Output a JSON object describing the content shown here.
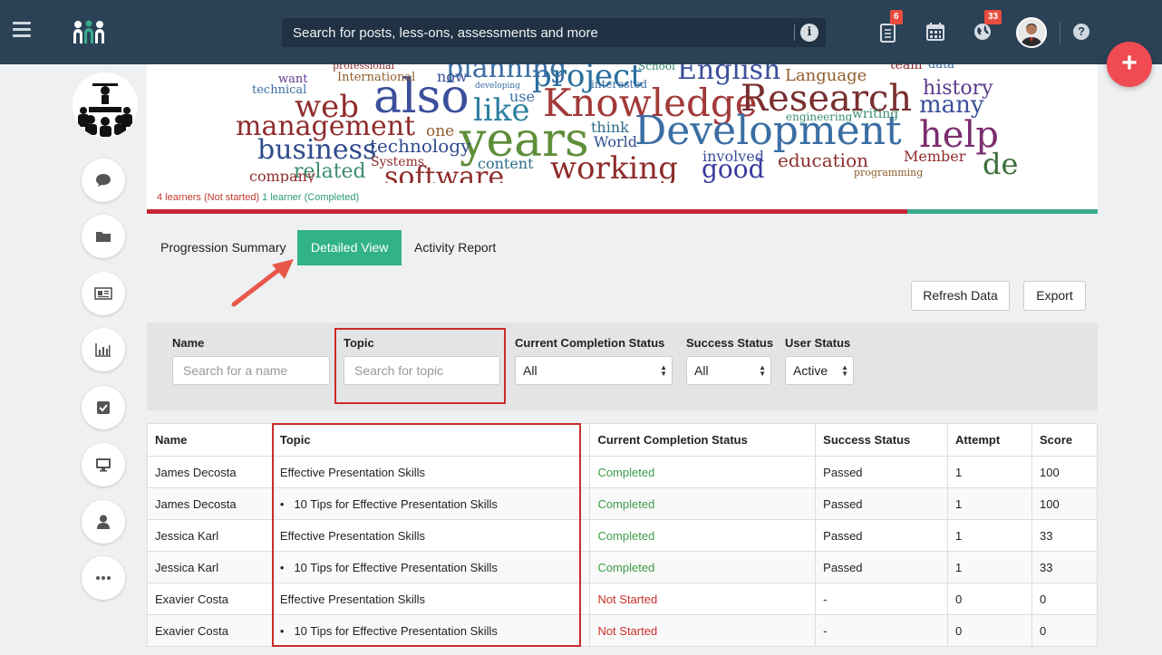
{
  "header": {
    "search_placeholder": "Search for posts, less-ons, assessments and more",
    "notifications_badge": "6",
    "globe_badge": "33",
    "help_label": "?",
    "info_label": "i",
    "fab_label": "+"
  },
  "sidebar": {
    "items": [
      "chat-icon",
      "folder-icon",
      "news-icon",
      "bar-chart-icon",
      "checkbox-icon",
      "monitor-icon",
      "user-icon",
      "more-icon"
    ]
  },
  "banner": {
    "cloud_words": [
      {
        "t": "also",
        "c": "#3b4f9c"
      },
      {
        "t": "project",
        "c": "#2a6e9e"
      },
      {
        "t": "English",
        "c": "#3b4f9c"
      },
      {
        "t": "Knowledge",
        "c": "#a23a3a"
      },
      {
        "t": "Research",
        "c": "#7a2f2f"
      },
      {
        "t": "years",
        "c": "#5f8e3a"
      },
      {
        "t": "Development",
        "c": "#3b6ea3"
      },
      {
        "t": "help",
        "c": "#7b2d6e"
      },
      {
        "t": "management",
        "c": "#8f2c2c"
      },
      {
        "t": "web",
        "c": "#8f2c2c"
      },
      {
        "t": "like",
        "c": "#2c7fa0"
      },
      {
        "t": "business",
        "c": "#2f4b8c"
      },
      {
        "t": "working",
        "c": "#8f2c2c"
      },
      {
        "t": "technology",
        "c": "#2f4b8c"
      },
      {
        "t": "good",
        "c": "#3b3b9c"
      },
      {
        "t": "education",
        "c": "#8f2c2c"
      },
      {
        "t": "related",
        "c": "#3b8c6e"
      },
      {
        "t": "software",
        "c": "#8f2c2c"
      },
      {
        "t": "history",
        "c": "#5c3a8c"
      },
      {
        "t": "many",
        "c": "#3b4f9c"
      },
      {
        "t": "de",
        "c": "#3b6e3b"
      },
      {
        "t": "Language",
        "c": "#8f5c2c"
      },
      {
        "t": "planning",
        "c": "#3b6ea3"
      },
      {
        "t": "content",
        "c": "#2f6e8c"
      },
      {
        "t": "World",
        "c": "#2f4b8c"
      },
      {
        "t": "think",
        "c": "#2f6e8c"
      },
      {
        "t": "company",
        "c": "#8f2c2c"
      },
      {
        "t": "technical",
        "c": "#3b6ea3"
      },
      {
        "t": "International",
        "c": "#8f5c2c"
      },
      {
        "t": "Systems",
        "c": "#8f2c2c"
      },
      {
        "t": "writing",
        "c": "#3b8c6e"
      },
      {
        "t": "Member",
        "c": "#8f2c2c"
      },
      {
        "t": "involved",
        "c": "#3b4f9c"
      },
      {
        "t": "engineering",
        "c": "#3b8c6e"
      },
      {
        "t": "programming",
        "c": "#8f5c2c"
      },
      {
        "t": "team",
        "c": "#8f2c2c"
      },
      {
        "t": "data",
        "c": "#3b6ea3"
      },
      {
        "t": "one",
        "c": "#8f5c2c"
      },
      {
        "t": "use",
        "c": "#3b6ea3"
      },
      {
        "t": "now",
        "c": "#3b4f9c"
      },
      {
        "t": "want",
        "c": "#5c3a8c"
      },
      {
        "t": "School",
        "c": "#3b8c6e"
      },
      {
        "t": "interested",
        "c": "#3b6ea3"
      },
      {
        "t": "developing",
        "c": "#3b6ea3"
      },
      {
        "t": "professional",
        "c": "#8f2c2c"
      }
    ],
    "not_started": "4 learners (Not started)",
    "completed": "1 learner (Completed)",
    "completed_fraction": 0.2
  },
  "tabs": [
    {
      "label": "Progression Summary",
      "active": false
    },
    {
      "label": "Detailed View",
      "active": true
    },
    {
      "label": "Activity Report",
      "active": false
    }
  ],
  "actions": {
    "refresh": "Refresh Data",
    "export": "Export"
  },
  "filters": {
    "name_label": "Name",
    "name_placeholder": "Search for a name",
    "topic_label": "Topic",
    "topic_placeholder": "Search for topic",
    "completion_label": "Current Completion Status",
    "completion_value": "All",
    "success_label": "Success Status",
    "success_value": "All",
    "user_label": "User Status",
    "user_value": "Active"
  },
  "table": {
    "headers": [
      "Name",
      "Topic",
      "Current Completion Status",
      "Success Status",
      "Attempt",
      "Score"
    ],
    "rows": [
      {
        "name": "James Decosta",
        "topic": "Effective Presentation Skills",
        "sub": false,
        "status": "Completed",
        "success": "Passed",
        "attempt": "1",
        "score": "100"
      },
      {
        "name": "James Decosta",
        "topic": "10 Tips for Effective Presentation Skills",
        "sub": true,
        "status": "Completed",
        "success": "Passed",
        "attempt": "1",
        "score": "100"
      },
      {
        "name": "Jessica Karl",
        "topic": "Effective Presentation Skills",
        "sub": false,
        "status": "Completed",
        "success": "Passed",
        "attempt": "1",
        "score": "33"
      },
      {
        "name": "Jessica Karl",
        "topic": "10 Tips for Effective Presentation Skills",
        "sub": true,
        "status": "Completed",
        "success": "Passed",
        "attempt": "1",
        "score": "33"
      },
      {
        "name": "Exavier Costa",
        "topic": "Effective Presentation Skills",
        "sub": false,
        "status": "Not Started",
        "success": "-",
        "attempt": "0",
        "score": "0"
      },
      {
        "name": "Exavier Costa",
        "topic": "10 Tips for Effective Presentation Skills",
        "sub": true,
        "status": "Not Started",
        "success": "-",
        "attempt": "0",
        "score": "0"
      }
    ]
  }
}
